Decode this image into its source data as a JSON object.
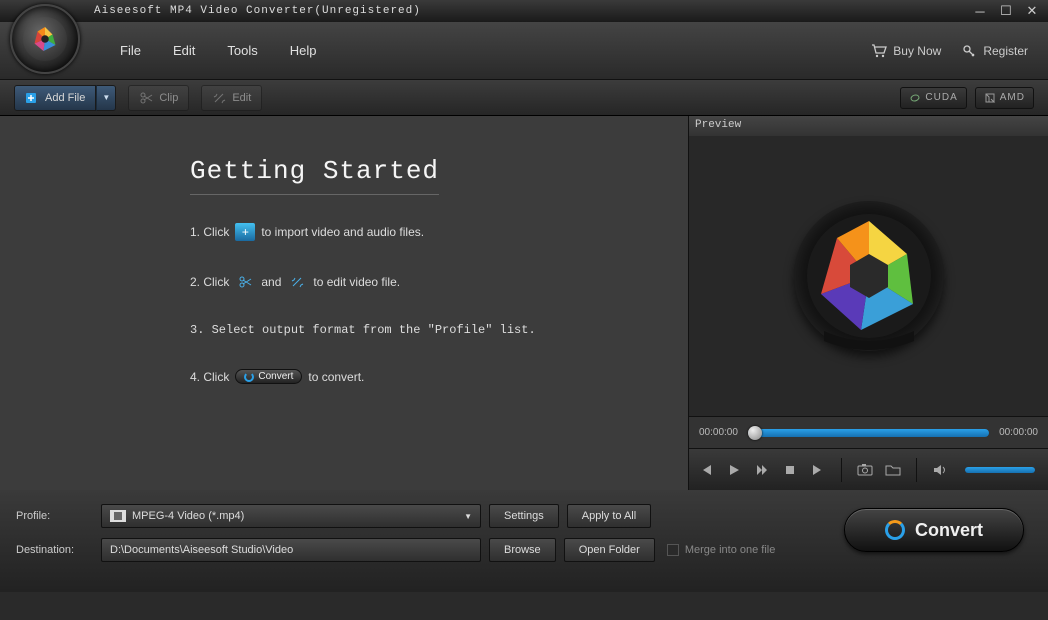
{
  "app": {
    "title": "Aiseesoft MP4 Video Converter(Unregistered)"
  },
  "menu": {
    "file": "File",
    "edit": "Edit",
    "tools": "Tools",
    "help": "Help",
    "buy_now": "Buy Now",
    "register": "Register"
  },
  "toolbar": {
    "add_file": "Add File",
    "clip": "Clip",
    "edit": "Edit",
    "cuda": "CUDA",
    "amd": "AMD"
  },
  "getting_started": {
    "title": "Getting Started",
    "line1_pre": "1. Click",
    "line1_post": "to import video and audio files.",
    "line2_pre": "2. Click",
    "line2_mid": "and",
    "line2_post": "to edit video file.",
    "line3": "3. Select output format from the \"Profile\" list.",
    "line4_pre": "4. Click",
    "line4_btn": "Convert",
    "line4_post": "to convert."
  },
  "preview": {
    "label": "Preview",
    "time_cur": "00:00:00",
    "time_total": "00:00:00"
  },
  "bottom": {
    "profile_label": "Profile:",
    "profile_value": "MPEG-4 Video (*.mp4)",
    "settings": "Settings",
    "apply_all": "Apply to All",
    "dest_label": "Destination:",
    "dest_value": "D:\\Documents\\Aiseesoft Studio\\Video",
    "browse": "Browse",
    "open_folder": "Open Folder",
    "merge": "Merge into one file",
    "convert": "Convert"
  }
}
